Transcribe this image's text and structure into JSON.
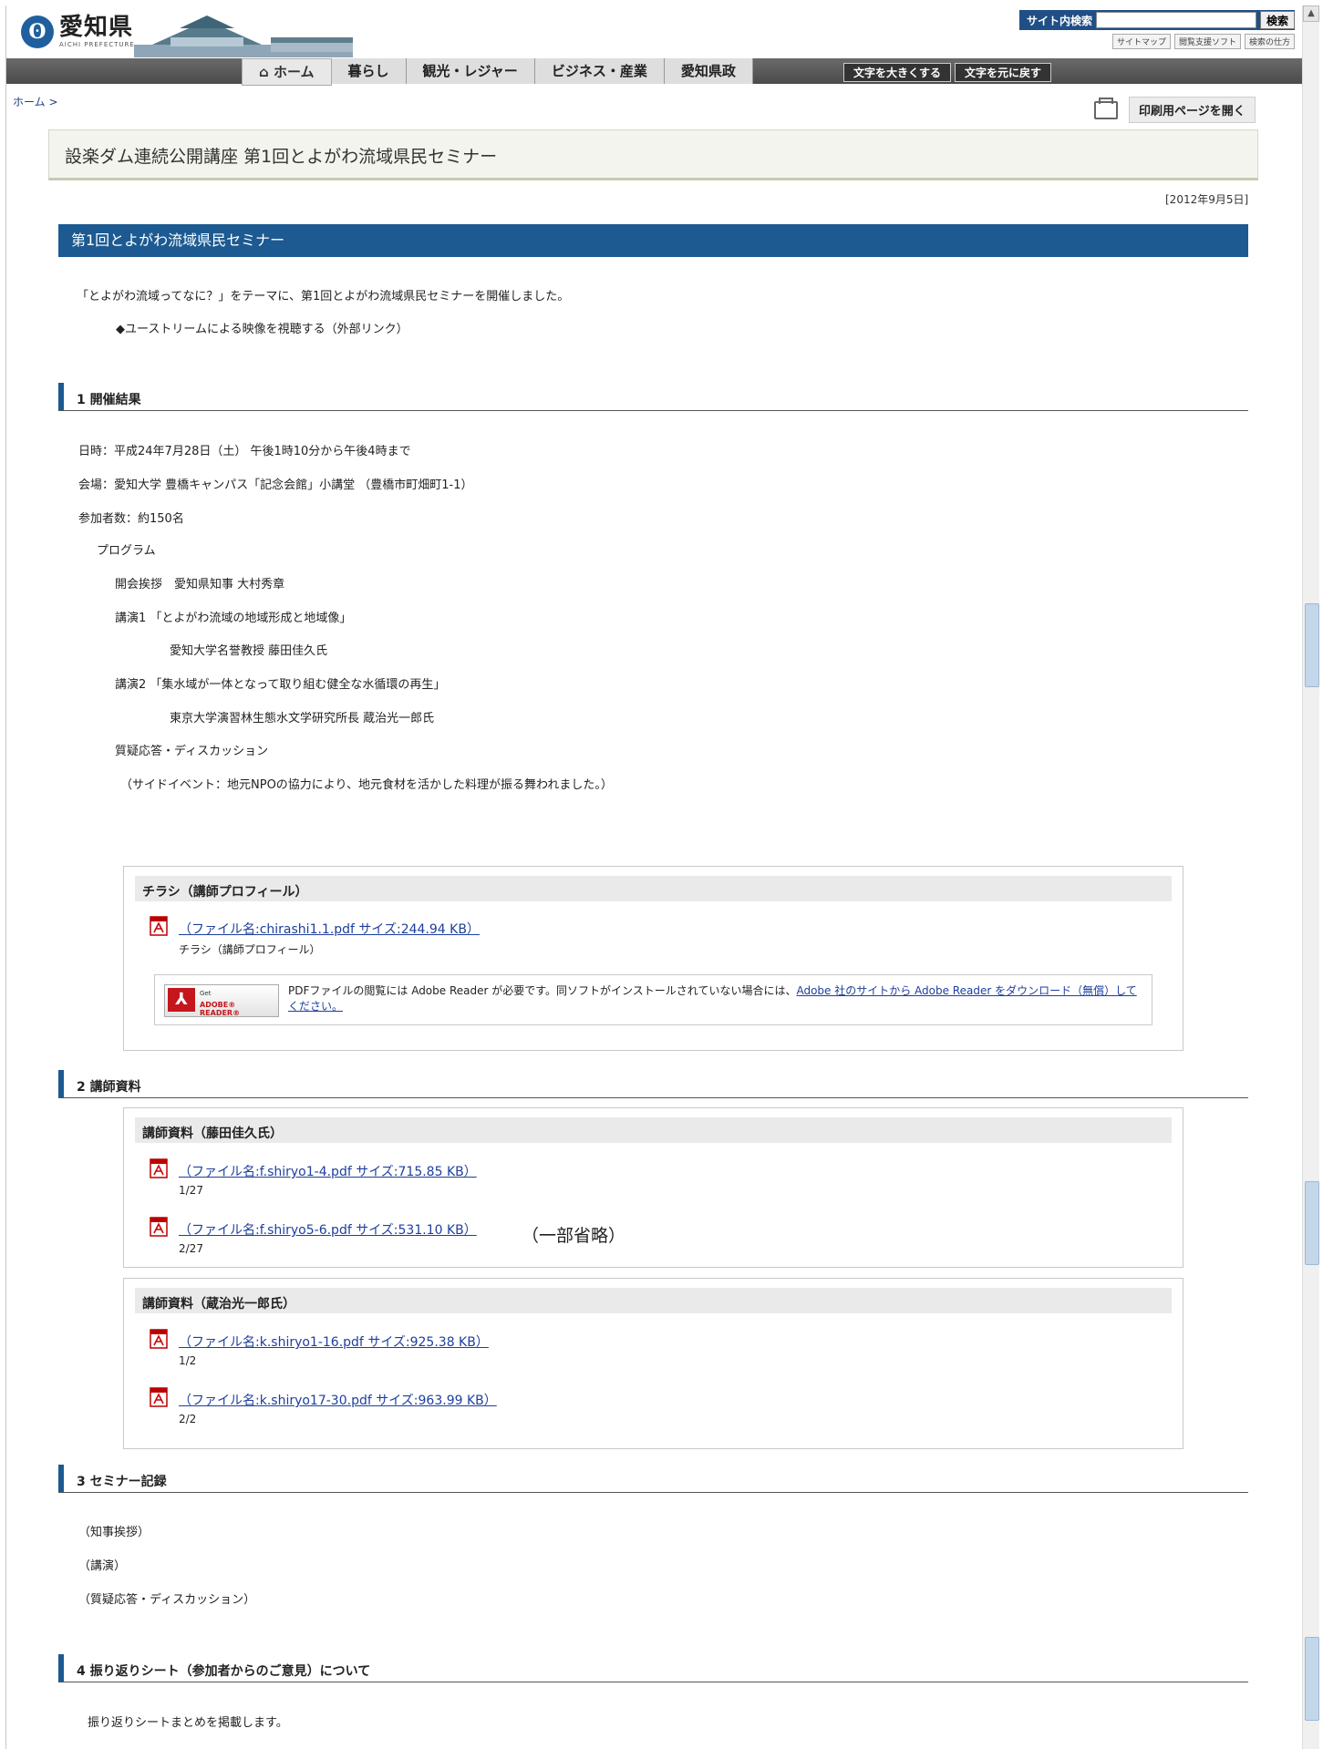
{
  "header": {
    "logo_text": "愛知県",
    "logo_sub": "AICHI PREFECTURE",
    "search_label": "サイト内検索",
    "search_value": "",
    "search_button": "検索",
    "util_links": [
      "サイトマップ",
      "閲覧支援ソフト",
      "検索の仕方"
    ]
  },
  "nav": {
    "items": [
      "ホーム",
      "暮らし",
      "観光・レジャー",
      "ビジネス・産業",
      "愛知県政"
    ],
    "font_larger": "文字を大きくする",
    "font_reset": "文字を元に戻す"
  },
  "breadcrumb": "ホーム >",
  "print_label": "印刷用ページを開く",
  "page_title": "設楽ダム連続公開講座 第1回とよがわ流域県民セミナー",
  "date": "[2012年9月5日]",
  "main_heading": "第1回とよがわ流域県民セミナー",
  "intro": "「とよがわ流域ってなに？」をテーマに、第1回とよがわ流域県民セミナーを開催しました。",
  "ustream_link": "◆ユーストリームによる映像を視聴する（外部リンク）",
  "sections": {
    "s1": "1 開催結果",
    "s2": "2 講師資料",
    "s3": "3 セミナー記録",
    "s4": "4 振り返りシート（参加者からのご意見）について"
  },
  "results": {
    "datetime": "日時：平成24年7月28日（土） 午後1時10分から午後4時まで",
    "venue": "会場：愛知大学 豊橋キャンパス「記念会館」小講堂 （豊橋市町畑町1-1）",
    "attendees": "参加者数：約150名",
    "program": "プログラム",
    "opening": "開会挨拶　愛知県知事 大村秀章",
    "lecture1": "講演1 「とよがわ流域の地域形成と地域像」",
    "lecturer1": "愛知大学名誉教授 藤田佳久氏",
    "lecture2": "講演2 「集水域が一体となって取り組む健全な水循環の再生」",
    "lecturer2": "東京大学演習林生態水文学研究所長 蔵治光一郎氏",
    "qa": "質疑応答・ディスカッション",
    "side_event": "（サイドイベント：地元NPOの協力により、地元食材を活かした料理が振る舞われました。）"
  },
  "flyer_box": {
    "title": "チラシ（講師プロフィール）",
    "file_link": "（ファイル名:chirashi1.1.pdf サイズ:244.94 KB）",
    "file_desc": "チラシ（講師プロフィール）",
    "adobe_get": "Get",
    "adobe_reader": "ADOBE® READER®",
    "adobe_text": "PDFファイルの閲覧には Adobe Reader が必要です。同ソフトがインストールされていない場合には、",
    "adobe_link": "Adobe 社のサイトから Adobe Reader をダウンロード（無償）してください。"
  },
  "fujita_box": {
    "title": "講師資料（藤田佳久氏）",
    "files": [
      {
        "link": "（ファイル名:f.shiryo1-4.pdf サイズ:715.85 KB）",
        "desc": "1/27"
      },
      {
        "link": "（ファイル名:f.shiryo5-6.pdf サイズ:531.10 KB）",
        "desc": "2/27"
      }
    ],
    "omitted": "（一部省略）"
  },
  "kuraji_box": {
    "title": "講師資料（蔵治光一郎氏）",
    "files": [
      {
        "link": "（ファイル名:k.shiryo1-16.pdf サイズ:925.38 KB）",
        "desc": "1/2"
      },
      {
        "link": "（ファイル名:k.shiryo17-30.pdf サイズ:963.99 KB）",
        "desc": "2/2"
      }
    ]
  },
  "records": [
    "（知事挨拶）",
    "（講演）",
    "（質疑応答・ディスカッション）"
  ],
  "feedback_text": "振り返りシートまとめを掲載します。"
}
